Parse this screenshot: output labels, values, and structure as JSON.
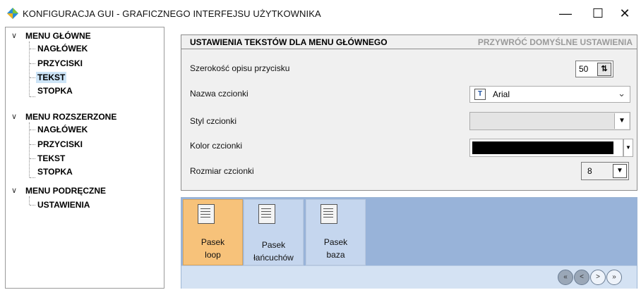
{
  "window": {
    "title": "KONFIGURACJA GUI - GRAFICZNEGO INTERFEJSU UŻYTKOWNIKA",
    "minimize_glyph": "—",
    "maximize_glyph": "☐",
    "close_glyph": "✕"
  },
  "tree": {
    "groups": [
      {
        "label": "MENU GŁÓWNE",
        "children": [
          "NAGŁÓWEK",
          "PRZYCISKI",
          "TEKST",
          "STOPKA"
        ]
      },
      {
        "label": "MENU ROZSZERZONE",
        "children": [
          "NAGŁÓWEK",
          "PRZYCISKI",
          "TEKST",
          "STOPKA"
        ]
      },
      {
        "label": "MENU PODRĘCZNE",
        "children": [
          "USTAWIENIA"
        ]
      }
    ],
    "selected": "MENU GŁÓWNE / TEKST"
  },
  "settings": {
    "title": "USTAWIENIA TEKSTÓW DLA MENU GŁÓWNEGO",
    "reset_label": "PRZYWRÓĆ DOMYŚLNE USTAWIENIA",
    "button_width_label": "Szerokość opisu przycisku",
    "button_width_value": "50",
    "font_name_label": "Nazwa czcionki",
    "font_name_value": "Arial",
    "font_style_label": "Styl czcionki",
    "font_style_value": "",
    "font_color_label": "Kolor czcionki",
    "font_color_value": "#000000",
    "font_size_label": "Rozmiar czcionki",
    "font_size_value": "8"
  },
  "toolbar": {
    "tiles": [
      {
        "line1": "Pasek",
        "line2": "loop",
        "active": true
      },
      {
        "line1": "Pasek",
        "line2": "łańcuchów",
        "active": false
      },
      {
        "line1": "Pasek",
        "line2": "baza",
        "active": false
      }
    ],
    "nav": {
      "first_glyph": "«",
      "prev_glyph": "<",
      "next_glyph": ">",
      "last_glyph": "»"
    }
  },
  "colors": {
    "selected_tile": "#f7c27a",
    "toolbar_background": "#98b3d9",
    "tree_selection": "#cce4f7"
  }
}
